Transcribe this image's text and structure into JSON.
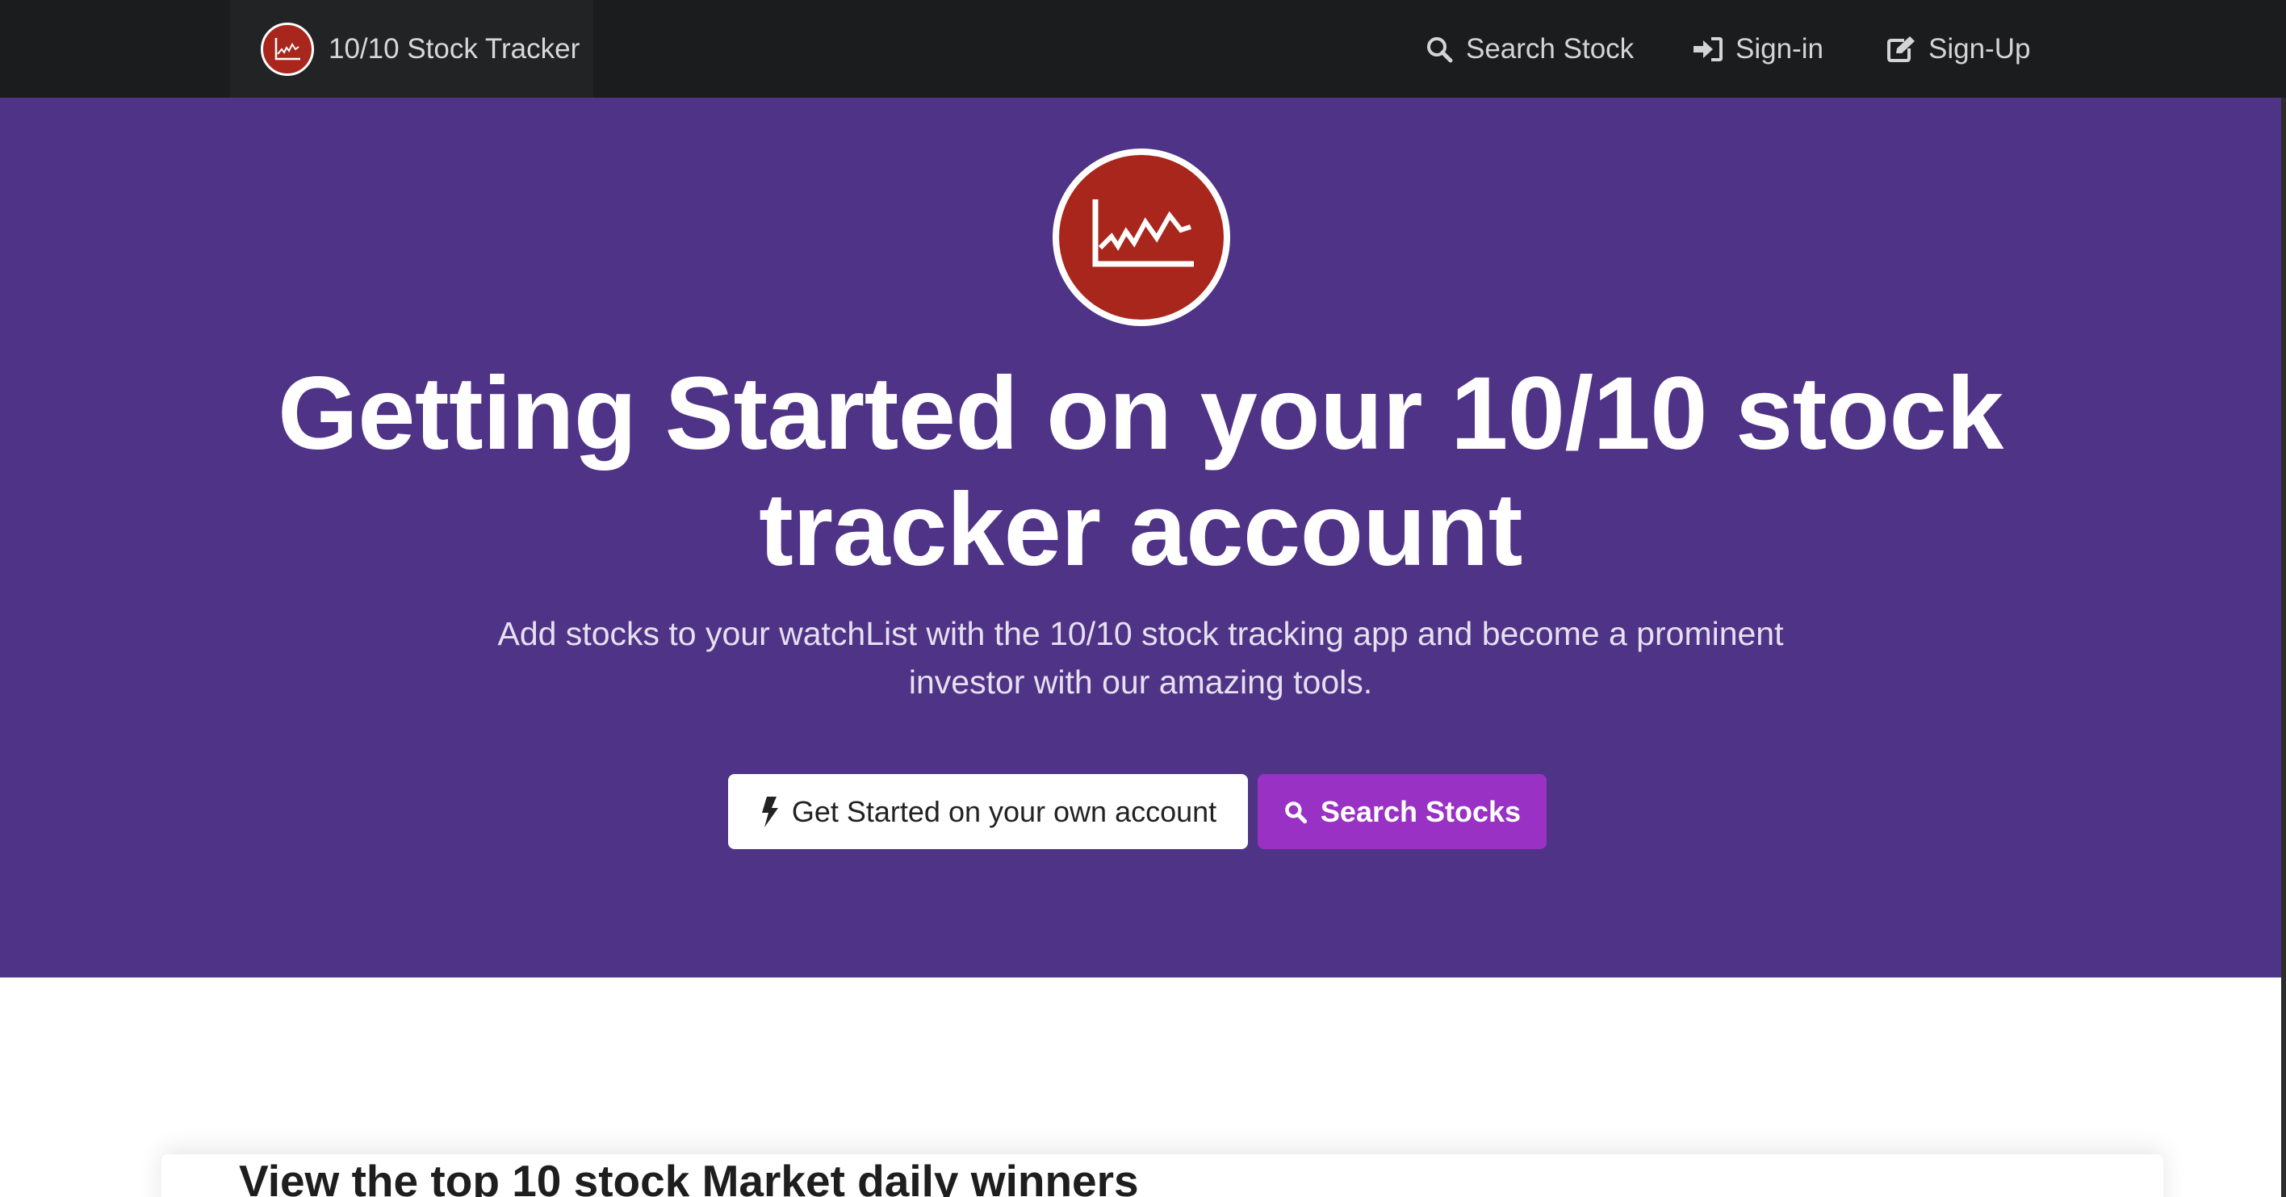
{
  "navbar": {
    "brand": "10/10 Stock Tracker",
    "items": [
      {
        "label": "Search Stock",
        "icon": "search-icon"
      },
      {
        "label": "Sign-in",
        "icon": "sign-in-icon"
      },
      {
        "label": "Sign-Up",
        "icon": "edit-icon"
      }
    ]
  },
  "hero": {
    "title": "Getting Started on your 10/10 stock tracker account",
    "subtitle": "Add stocks to your watchList with the 10/10 stock tracking app and become a prominent investor with our amazing tools.",
    "primary_button": {
      "label": "Get Started on your own account",
      "icon": "bolt-icon"
    },
    "secondary_button": {
      "label": "Search Stocks",
      "icon": "search-icon"
    }
  },
  "section": {
    "heading": "View the top 10 stock Market daily winners"
  },
  "colors": {
    "navbar": "#1b1c1d",
    "hero": "#4f3386",
    "logo": "#a8261b",
    "accent_button": "#9932c4"
  }
}
